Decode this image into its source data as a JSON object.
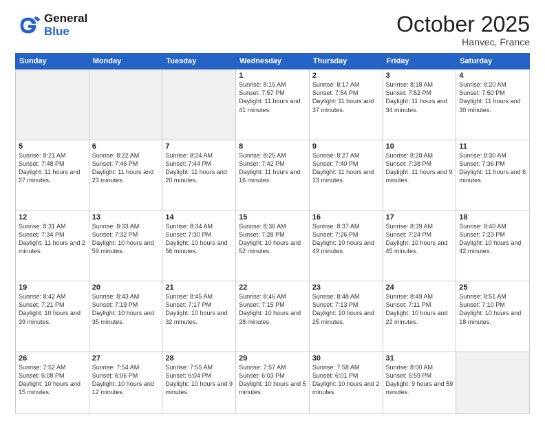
{
  "header": {
    "logo_general": "General",
    "logo_blue": "Blue",
    "month_title": "October 2025",
    "location": "Hanvec, France"
  },
  "days_of_week": [
    "Sunday",
    "Monday",
    "Tuesday",
    "Wednesday",
    "Thursday",
    "Friday",
    "Saturday"
  ],
  "weeks": [
    [
      {
        "day": "",
        "empty": true
      },
      {
        "day": "",
        "empty": true
      },
      {
        "day": "",
        "empty": true
      },
      {
        "day": "1",
        "sunrise": "8:15 AM",
        "sunset": "7:57 PM",
        "daylight": "11 hours and 41 minutes."
      },
      {
        "day": "2",
        "sunrise": "8:17 AM",
        "sunset": "7:54 PM",
        "daylight": "11 hours and 37 minutes."
      },
      {
        "day": "3",
        "sunrise": "8:18 AM",
        "sunset": "7:52 PM",
        "daylight": "11 hours and 34 minutes."
      },
      {
        "day": "4",
        "sunrise": "8:20 AM",
        "sunset": "7:50 PM",
        "daylight": "11 hours and 30 minutes."
      }
    ],
    [
      {
        "day": "5",
        "sunrise": "8:21 AM",
        "sunset": "7:48 PM",
        "daylight": "11 hours and 27 minutes."
      },
      {
        "day": "6",
        "sunrise": "8:22 AM",
        "sunset": "7:46 PM",
        "daylight": "11 hours and 23 minutes."
      },
      {
        "day": "7",
        "sunrise": "8:24 AM",
        "sunset": "7:44 PM",
        "daylight": "11 hours and 20 minutes."
      },
      {
        "day": "8",
        "sunrise": "8:25 AM",
        "sunset": "7:42 PM",
        "daylight": "11 hours and 16 minutes."
      },
      {
        "day": "9",
        "sunrise": "8:27 AM",
        "sunset": "7:40 PM",
        "daylight": "11 hours and 13 minutes."
      },
      {
        "day": "10",
        "sunrise": "8:28 AM",
        "sunset": "7:38 PM",
        "daylight": "11 hours and 9 minutes."
      },
      {
        "day": "11",
        "sunrise": "8:30 AM",
        "sunset": "7:36 PM",
        "daylight": "11 hours and 6 minutes."
      }
    ],
    [
      {
        "day": "12",
        "sunrise": "8:31 AM",
        "sunset": "7:34 PM",
        "daylight": "11 hours and 2 minutes."
      },
      {
        "day": "13",
        "sunrise": "8:33 AM",
        "sunset": "7:32 PM",
        "daylight": "10 hours and 59 minutes."
      },
      {
        "day": "14",
        "sunrise": "8:34 AM",
        "sunset": "7:30 PM",
        "daylight": "10 hours and 56 minutes."
      },
      {
        "day": "15",
        "sunrise": "8:36 AM",
        "sunset": "7:28 PM",
        "daylight": "10 hours and 52 minutes."
      },
      {
        "day": "16",
        "sunrise": "8:37 AM",
        "sunset": "7:26 PM",
        "daylight": "10 hours and 49 minutes."
      },
      {
        "day": "17",
        "sunrise": "8:39 AM",
        "sunset": "7:24 PM",
        "daylight": "10 hours and 45 minutes."
      },
      {
        "day": "18",
        "sunrise": "8:40 AM",
        "sunset": "7:23 PM",
        "daylight": "10 hours and 42 minutes."
      }
    ],
    [
      {
        "day": "19",
        "sunrise": "8:42 AM",
        "sunset": "7:21 PM",
        "daylight": "10 hours and 39 minutes."
      },
      {
        "day": "20",
        "sunrise": "8:43 AM",
        "sunset": "7:19 PM",
        "daylight": "10 hours and 35 minutes."
      },
      {
        "day": "21",
        "sunrise": "8:45 AM",
        "sunset": "7:17 PM",
        "daylight": "10 hours and 32 minutes."
      },
      {
        "day": "22",
        "sunrise": "8:46 AM",
        "sunset": "7:15 PM",
        "daylight": "10 hours and 28 minutes."
      },
      {
        "day": "23",
        "sunrise": "8:48 AM",
        "sunset": "7:13 PM",
        "daylight": "10 hours and 25 minutes."
      },
      {
        "day": "24",
        "sunrise": "8:49 AM",
        "sunset": "7:11 PM",
        "daylight": "10 hours and 22 minutes."
      },
      {
        "day": "25",
        "sunrise": "8:51 AM",
        "sunset": "7:10 PM",
        "daylight": "10 hours and 18 minutes."
      }
    ],
    [
      {
        "day": "26",
        "sunrise": "7:52 AM",
        "sunset": "6:08 PM",
        "daylight": "10 hours and 15 minutes."
      },
      {
        "day": "27",
        "sunrise": "7:54 AM",
        "sunset": "6:06 PM",
        "daylight": "10 hours and 12 minutes."
      },
      {
        "day": "28",
        "sunrise": "7:55 AM",
        "sunset": "6:04 PM",
        "daylight": "10 hours and 9 minutes."
      },
      {
        "day": "29",
        "sunrise": "7:57 AM",
        "sunset": "6:03 PM",
        "daylight": "10 hours and 5 minutes."
      },
      {
        "day": "30",
        "sunrise": "7:58 AM",
        "sunset": "6:01 PM",
        "daylight": "10 hours and 2 minutes."
      },
      {
        "day": "31",
        "sunrise": "8:00 AM",
        "sunset": "5:59 PM",
        "daylight": "9 hours and 59 minutes."
      },
      {
        "day": "",
        "empty": true
      }
    ]
  ]
}
